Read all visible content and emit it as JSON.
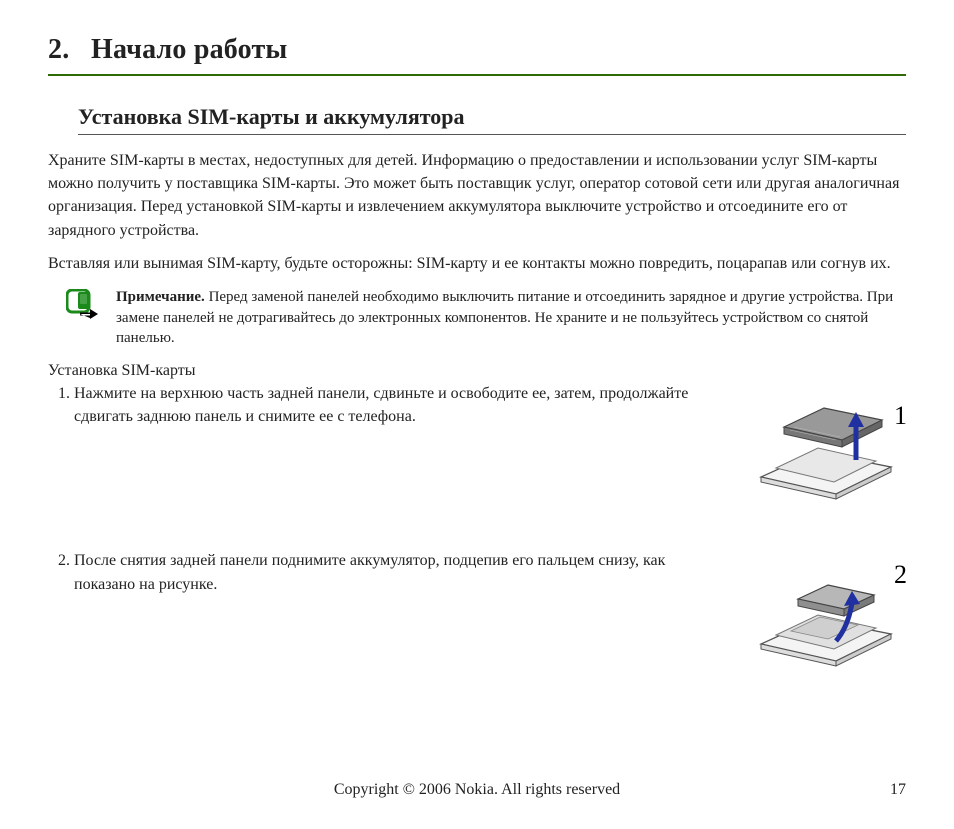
{
  "chapter": {
    "number": "2.",
    "title": "Начало работы"
  },
  "section": {
    "title": "Установка SIM-карты и аккумулятора"
  },
  "paragraphs": {
    "p1": "Храните SIM-карты в местах, недоступных для детей. Информацию о предоставлении и использовании услуг SIM-карты можно получить у поставщика SIM-карты. Это может быть поставщик услуг, оператор сотовой сети или другая аналогичная организация. Перед установкой SIM-карты и извлечением аккумулятора выключите устройство и отсоедините его от зарядного устройства.",
    "p2": "Вставляя или вынимая SIM-карту, будьте осторожны: SIM-карту и ее контакты можно повредить, поцарапав или согнув их."
  },
  "note": {
    "label": "Примечание.",
    "text": " Перед заменой панелей необходимо выключить питание и отсоединить зарядное и другие устройства. При замене панелей не дотрагивайтесь до электронных компонентов. Не храните и не пользуйтесь устройством со снятой панелью."
  },
  "subheading": "Установка SIM-карты",
  "steps": [
    {
      "text": "Нажмите на верхнюю часть задней панели, сдвиньте и освободите ее, затем, продолжайте сдвигать заднюю панель и снимите ее с телефона.",
      "fig_label": "1"
    },
    {
      "text": "После снятия задней панели поднимите аккумулятор, подцепив его пальцем снизу, как показано на рисунке.",
      "fig_label": "2"
    }
  ],
  "footer": {
    "copyright": "Copyright © 2006 Nokia. All rights reserved",
    "page": "17"
  }
}
